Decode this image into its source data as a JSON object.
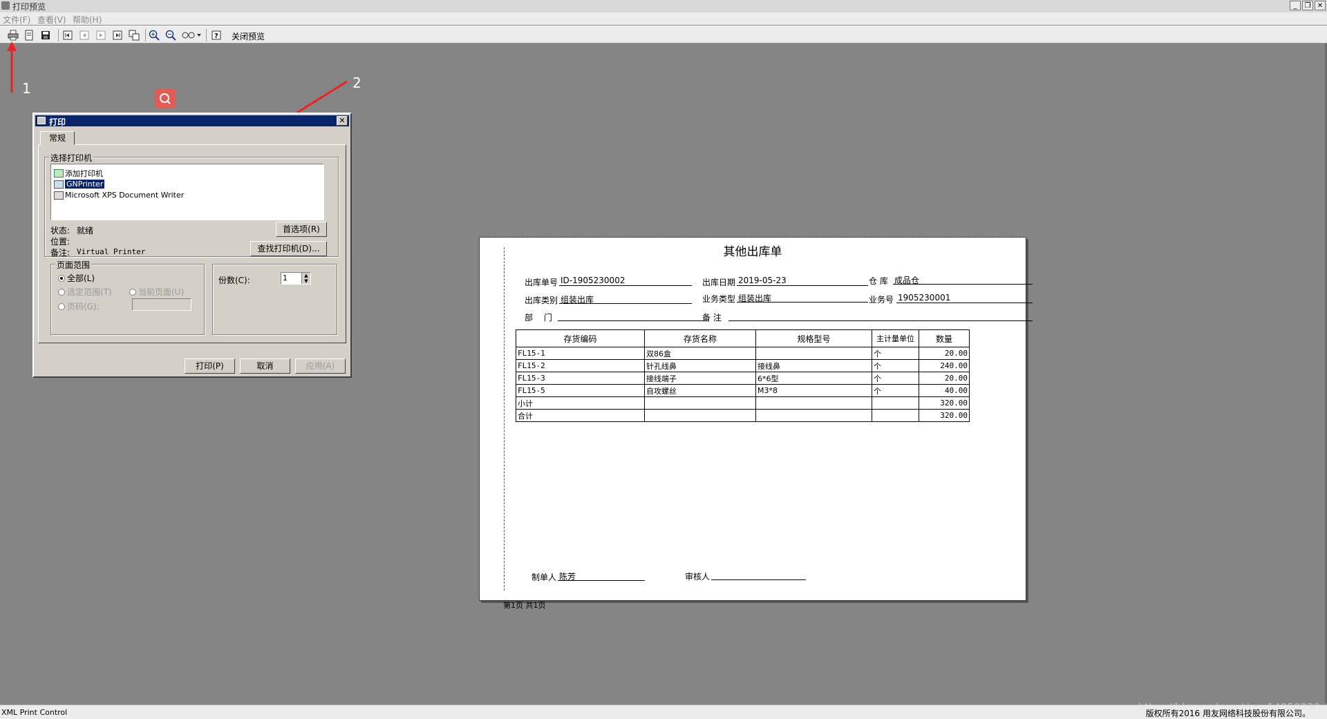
{
  "window": {
    "title": "打印预览"
  },
  "menu": [
    "文件(F)",
    "查看(V)",
    "帮助(H)"
  ],
  "toolbar": {
    "icons": [
      "print-icon",
      "page-setup-icon",
      "save-icon",
      "first-page-icon",
      "prev-page-icon",
      "next-page-icon",
      "last-page-icon",
      "goto-page-icon",
      "zoom-in-icon",
      "zoom-out-icon",
      "page-layout-icon",
      "help-icon"
    ],
    "close_preview_label": "关闭预览"
  },
  "annotations": {
    "marker1": "1",
    "marker2": "2",
    "arrow_color": "#ee2222"
  },
  "print_dialog": {
    "title": "打印",
    "tab": "常规",
    "select_printer_label": "选择打印机",
    "printers": [
      "添加打印机",
      "GNPrinter",
      "Microsoft XPS Document Writer"
    ],
    "selected_printer": "GNPrinter",
    "status_label": "状态:",
    "status_value": "就绪",
    "location_label": "位置:",
    "comment_label": "备注:",
    "comment_value": "Virtual Printer",
    "preferences_button": "首选项(R)",
    "find_printer_button": "查找打印机(D)...",
    "page_range_label": "页面范围",
    "range_all": "全部(L)",
    "range_selection": "选定范围(T)",
    "range_current": "当前页面(U)",
    "range_pages": "页码(G):",
    "copies_label": "份数(C):",
    "copies_value": "1",
    "print_button": "打印(P)",
    "cancel_button": "取消",
    "apply_button": "应用(A)"
  },
  "document": {
    "title": "其他出库单",
    "fields": {
      "order_no_label": "出库单号",
      "order_no": "ID-1905230002",
      "date_label": "出库日期",
      "date": "2019-05-23",
      "warehouse_label": "仓 库",
      "warehouse": "成品仓",
      "category_label": "出库类别",
      "category": "组装出库",
      "biz_type_label": "业务类型",
      "biz_type": "组装出库",
      "biz_no_label": "业务号",
      "biz_no": "1905230001",
      "dept_label": "部 门",
      "dept": "",
      "remark_label": "备 注",
      "remark": ""
    },
    "table": {
      "headers": [
        "存货编码",
        "存货名称",
        "规格型号",
        "主计量单位",
        "数量"
      ],
      "rows": [
        [
          "FL15-1",
          "双86盒",
          "",
          "个",
          "20.00"
        ],
        [
          "FL15-2",
          "针孔线鼻",
          "接线鼻",
          "个",
          "240.00"
        ],
        [
          "FL15-3",
          "接线端子",
          "6*6型",
          "个",
          "20.00"
        ],
        [
          "FL15-5",
          "自攻螺丝",
          "M3*8",
          "个",
          "40.00"
        ],
        [
          "小计",
          "",
          "",
          "",
          "320.00"
        ],
        [
          "合计",
          "",
          "",
          "",
          "320.00"
        ]
      ]
    },
    "maker_label": "制单人",
    "maker": "陈芳",
    "reviewer_label": "审核人",
    "reviewer": "",
    "page_footer": "第1页 共1页"
  },
  "statusbar": {
    "left": "XML Print Control",
    "right": "版权所有2016 用友网络科技股份有限公司。",
    "watermark": "https://blog.csdn.net/qq_14950230"
  }
}
